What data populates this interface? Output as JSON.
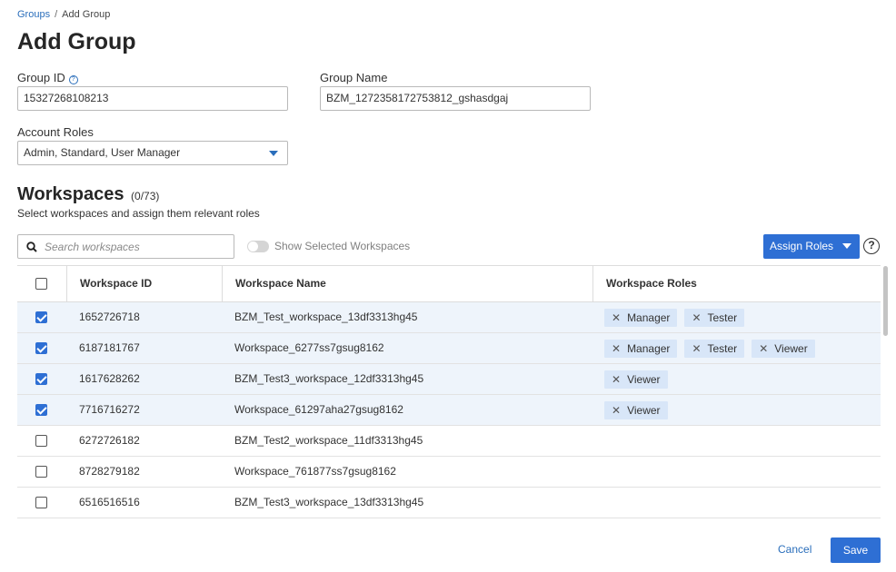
{
  "breadcrumb": {
    "parent": "Groups",
    "separator": "/",
    "current": "Add Group"
  },
  "page_title": "Add Group",
  "group_id": {
    "label": "Group ID",
    "value": "15327268108213",
    "help_icon": "question-circle-icon"
  },
  "group_name": {
    "label": "Group Name",
    "value": "BZM_1272358172753812_gshasdgaj"
  },
  "account_roles": {
    "label": "Account Roles",
    "value": "Admin, Standard, User Manager"
  },
  "workspaces": {
    "title": "Workspaces",
    "count": "(0/73)",
    "description": "Select workspaces and assign them relevant roles",
    "search_placeholder": "Search workspaces",
    "toggle_label": "Show Selected Workspaces",
    "toggle_on": false,
    "assign_button": "Assign Roles",
    "help_icon": "?",
    "columns": [
      "Workspace ID",
      "Workspace Name",
      "Workspace Roles"
    ],
    "rows": [
      {
        "checked": true,
        "id": "1652726718",
        "name": "BZM_Test_workspace_13df3313hg45",
        "roles": [
          "Manager",
          "Tester"
        ]
      },
      {
        "checked": true,
        "id": "6187181767",
        "name": "Workspace_6277ss7gsug8162",
        "roles": [
          "Manager",
          "Tester",
          "Viewer"
        ]
      },
      {
        "checked": true,
        "id": "1617628262",
        "name": "BZM_Test3_workspace_12df3313hg45",
        "roles": [
          "Viewer"
        ]
      },
      {
        "checked": true,
        "id": "7716716272",
        "name": "Workspace_61297aha27gsug8162",
        "roles": [
          "Viewer"
        ]
      },
      {
        "checked": false,
        "id": "6272726182",
        "name": "BZM_Test2_workspace_11df3313hg45",
        "roles": []
      },
      {
        "checked": false,
        "id": "8728279182",
        "name": "Workspace_761877ss7gsug8162",
        "roles": []
      },
      {
        "checked": false,
        "id": "6516516516",
        "name": "BZM_Test3_workspace_13df3313hg45",
        "roles": []
      }
    ],
    "chip_remove_glyph": "✕"
  },
  "footer": {
    "cancel": "Cancel",
    "save": "Save"
  },
  "colors": {
    "primary": "#2e6fd4",
    "link": "#2a6ebb",
    "selected_row": "#eef4fb",
    "chip": "#d8e6f8"
  }
}
